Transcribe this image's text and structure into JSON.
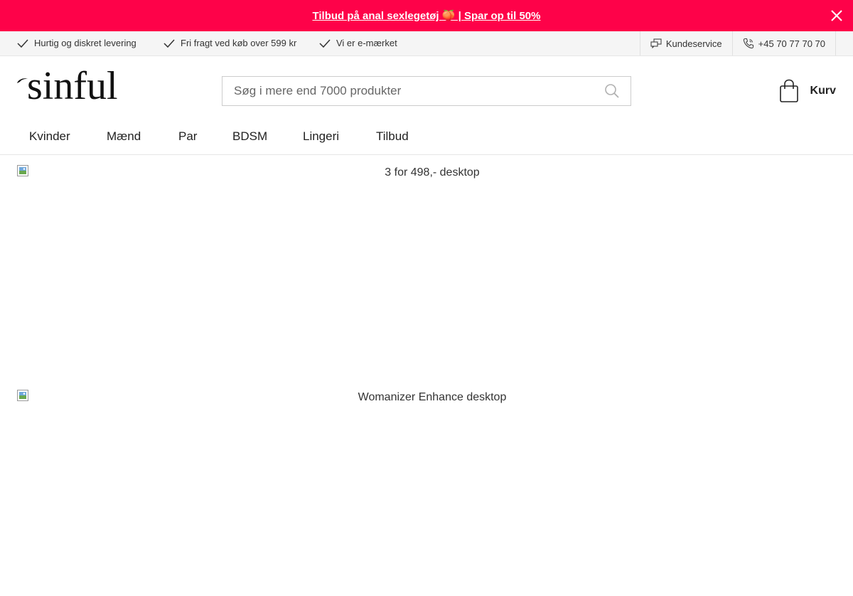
{
  "promo": {
    "text": "Tilbud på anal sexlegetøj 🍑 | Spar op til 50%",
    "background": "#fe0249",
    "close_icon": "close-icon"
  },
  "usp": {
    "items": [
      "Hurtig og diskret levering",
      "Fri fragt ved køb over 599 kr",
      "Vi er e-mærket"
    ],
    "customer_service": "Kundeservice",
    "phone": "+45 70 77 70 70"
  },
  "header": {
    "logo": "sinful",
    "search_placeholder": "Søg i mere end 7000 produkter",
    "cart_label": "Kurv"
  },
  "nav": {
    "items": [
      "Kvinder",
      "Mænd",
      "Par",
      "BDSM",
      "Lingeri",
      "Tilbud"
    ]
  },
  "banners": [
    {
      "alt": "3 for 498,- desktop"
    },
    {
      "alt": "Womanizer Enhance desktop"
    }
  ]
}
